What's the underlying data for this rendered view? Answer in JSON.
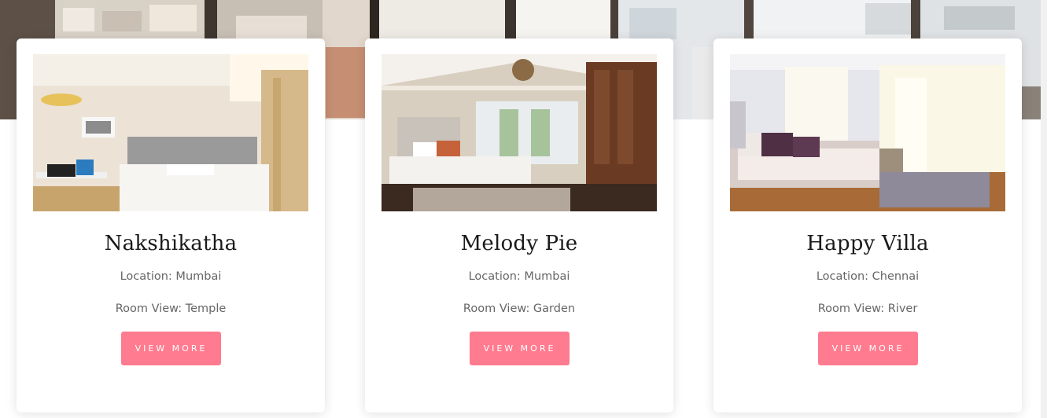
{
  "hero": {
    "image": "city-view-through-window"
  },
  "cards": [
    {
      "image": "hotel-room-bed-with-desk",
      "title": "Nakshikatha",
      "location": "Location: Mumbai",
      "room_view": "Room View: Temple",
      "button_label": "VIEW MORE"
    },
    {
      "image": "bedroom-with-chandelier-and-wooden-wardrobe",
      "title": "Melody Pie",
      "location": "Location: Mumbai",
      "room_view": "Room View: Garden",
      "button_label": "VIEW MORE"
    },
    {
      "image": "bright-bedroom-with-curtains-and-rug",
      "title": "Happy Villa",
      "location": "Location: Chennai",
      "room_view": "Room View: River",
      "button_label": "VIEW MORE"
    }
  ],
  "colors": {
    "button_bg": "#ff7b8f",
    "button_text": "#ffffff",
    "title_text": "#1a1a1a",
    "meta_text": "#666666"
  }
}
